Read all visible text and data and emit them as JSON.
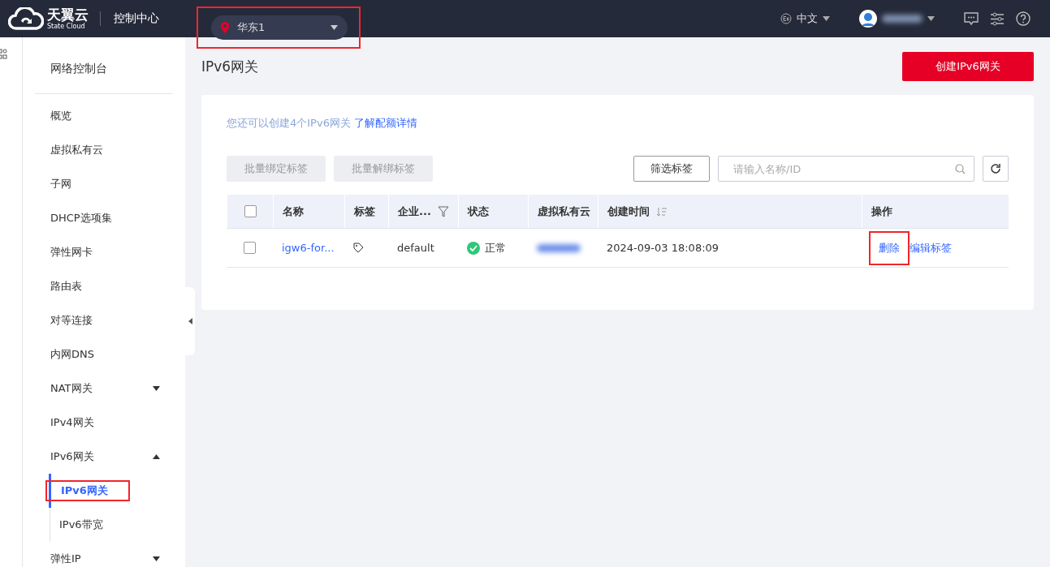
{
  "topbar": {
    "brand": "天翼云",
    "brand_sub": "State Cloud",
    "console": "控制中心",
    "region": {
      "label": "华东1",
      "highlighted": true
    },
    "language": "中文",
    "user_name_redacted": true
  },
  "sidebar": {
    "title": "网络控制台",
    "items": [
      {
        "kind": "link",
        "label": "概览",
        "selected": false
      },
      {
        "kind": "link",
        "label": "虚拟私有云",
        "selected": false
      },
      {
        "kind": "link",
        "label": "子网",
        "selected": false
      },
      {
        "kind": "link",
        "label": "DHCP选项集",
        "selected": false
      },
      {
        "kind": "link",
        "label": "弹性网卡",
        "selected": false
      },
      {
        "kind": "link",
        "label": "路由表",
        "selected": false
      },
      {
        "kind": "link",
        "label": "对等连接",
        "selected": false
      },
      {
        "kind": "link",
        "label": "内网DNS",
        "selected": false
      },
      {
        "kind": "group",
        "label": "NAT网关",
        "expanded": false
      },
      {
        "kind": "link",
        "label": "IPv4网关",
        "selected": false
      },
      {
        "kind": "group",
        "label": "IPv6网关",
        "expanded": true,
        "children": [
          {
            "label": "IPv6网关",
            "selected": true,
            "highlighted": true
          },
          {
            "label": "IPv6带宽",
            "selected": false,
            "highlighted": false
          }
        ]
      },
      {
        "kind": "group",
        "label": "弹性IP",
        "expanded": false
      }
    ]
  },
  "page": {
    "title": "IPv6网关",
    "create_button": "创建IPv6网关"
  },
  "quota": {
    "text": "您还可以创建4个IPv6网关",
    "link": "了解配额详情"
  },
  "toolbar": {
    "bind_button": {
      "label": "批量绑定标签",
      "disabled": true
    },
    "unbind_button": {
      "label": "批量解绑标签",
      "disabled": true
    },
    "filter_tags_button": "筛选标签",
    "search": {
      "placeholder": "请输入名称/ID"
    }
  },
  "table": {
    "columns": [
      {
        "kind": "check",
        "checked": false
      },
      {
        "kind": "plain",
        "label": "名称"
      },
      {
        "kind": "plain",
        "label": "标签"
      },
      {
        "kind": "filter",
        "label": "企业..."
      },
      {
        "kind": "plain",
        "label": "状态"
      },
      {
        "kind": "plain",
        "label": "虚拟私有云"
      },
      {
        "kind": "sort",
        "label": "创建时间"
      },
      {
        "kind": "plain",
        "label": "操作"
      }
    ],
    "rows": [
      {
        "checked": false,
        "name": "igw6-for...",
        "enterprise": "default",
        "status": {
          "label": "正常",
          "color": "#2fc77a"
        },
        "vpc_redacted": true,
        "created": "2024-09-03 18:08:09",
        "actions": [
          {
            "label": "删除",
            "highlighted": true
          },
          {
            "label": "编辑标签",
            "highlighted": false
          }
        ]
      }
    ]
  }
}
